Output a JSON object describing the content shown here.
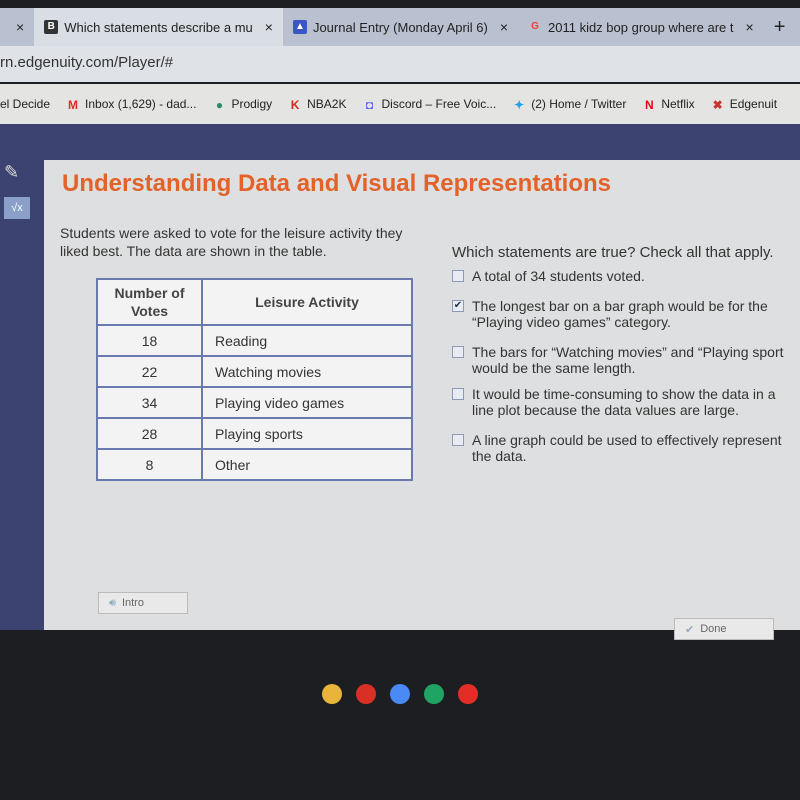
{
  "browser": {
    "tabs": [
      {
        "label": "Which statements describe a mu",
        "icon": "brainly-icon",
        "color": "#333"
      },
      {
        "label": "Journal Entry (Monday April 6)",
        "icon": "classroom-icon",
        "color": "#3a55c4"
      },
      {
        "label": "2011 kidz bop group where are t",
        "icon": "google-icon",
        "color": "#e94235"
      }
    ],
    "close_glyph": "×",
    "new_tab": "+",
    "url": "rn.edgenuity.com/Player/#",
    "bookmarks": [
      {
        "label": "el Decide",
        "icon": "",
        "glyph": ""
      },
      {
        "label": "Inbox (1,629) - dad...",
        "icon": "gmail-icon",
        "glyph": "M",
        "color": "#d93025"
      },
      {
        "label": "Prodigy",
        "icon": "prodigy-icon",
        "glyph": "●",
        "color": "#2a8a6a"
      },
      {
        "label": "NBA2K",
        "icon": "nba2k-icon",
        "glyph": "K",
        "color": "#d22"
      },
      {
        "label": "Discord – Free Voic...",
        "icon": "discord-icon",
        "glyph": "◘",
        "color": "#5865f2"
      },
      {
        "label": "(2) Home / Twitter",
        "icon": "twitter-icon",
        "glyph": "✦",
        "color": "#1da1f2"
      },
      {
        "label": "Netflix",
        "icon": "netflix-icon",
        "glyph": "N",
        "color": "#e50914"
      },
      {
        "label": "Edgenuit",
        "icon": "edgenuity-icon",
        "glyph": "✖",
        "color": "#c33"
      }
    ]
  },
  "page": {
    "title": "Understanding Data and Visual Representations",
    "intro": "Students were asked to vote for the leisure activity they liked best. The data are shown in the table.",
    "table": {
      "headers": [
        "Number of Votes",
        "Leisure Activity"
      ],
      "rows": [
        [
          "18",
          "Reading"
        ],
        [
          "22",
          "Watching movies"
        ],
        [
          "34",
          "Playing video games"
        ],
        [
          "28",
          "Playing sports"
        ],
        [
          "8",
          "Other"
        ]
      ]
    },
    "question": "Which statements are true? Check all that apply.",
    "options": [
      {
        "label": "A total of 34 students voted.",
        "checked": false
      },
      {
        "label": "The longest bar on a bar graph would be for the “Playing video games” category.",
        "checked": true
      },
      {
        "label": "The bars for “Watching movies” and “Playing sport would be the same length.",
        "checked": false
      },
      {
        "label": "It would be time-consuming to show the data in a line plot because the data values are large.",
        "checked": false
      },
      {
        "label": "A line graph could be used to effectively represent the data.",
        "checked": false
      }
    ],
    "intro_button": "Intro",
    "done_button": "Done",
    "check_glyph": "✔"
  },
  "taskbar": {
    "apps": [
      "chrome",
      "gmail",
      "docs",
      "play",
      "youtube"
    ],
    "colors": [
      "#e8b43a",
      "#d93025",
      "#4a8af4",
      "#1fa463",
      "#e52d27"
    ]
  }
}
